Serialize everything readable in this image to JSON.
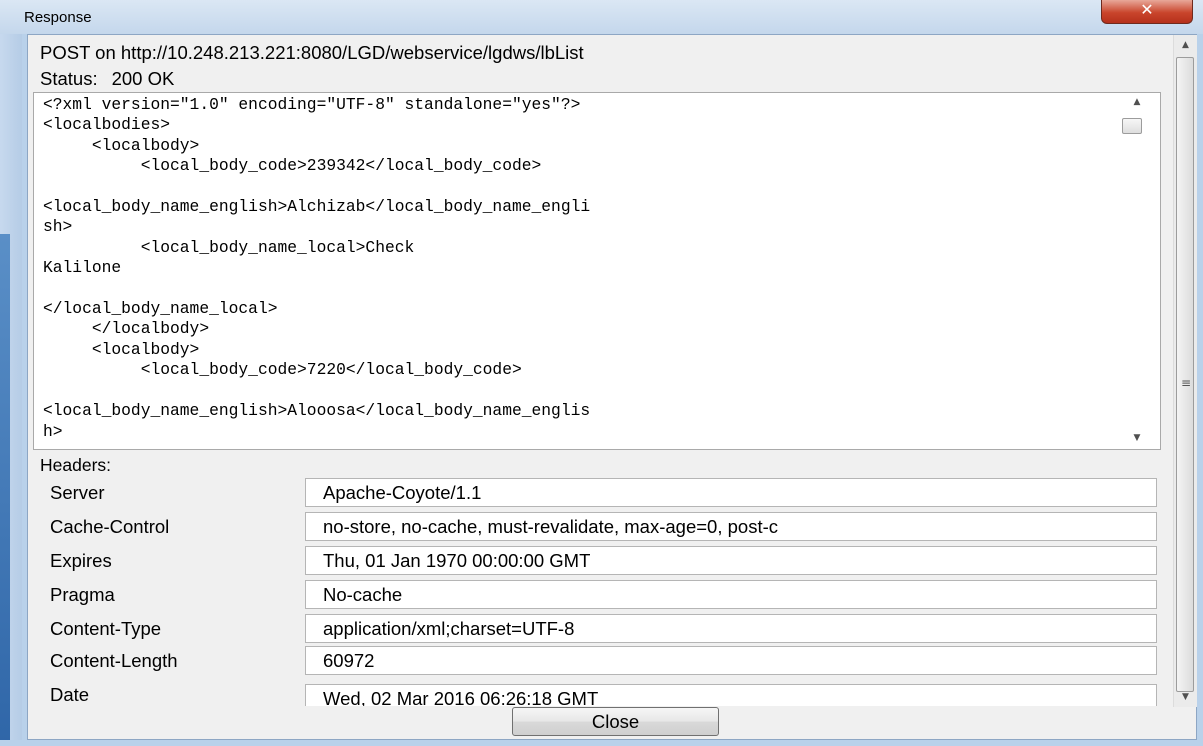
{
  "window": {
    "title": "Response",
    "close_glyph": "✕"
  },
  "request": {
    "line": "POST on http://10.248.213.221:8080/LGD/webservice/lgdws/lbList",
    "status_label": "Status:",
    "status_value": "200 OK"
  },
  "body": {
    "text": "<?xml version=\"1.0\" encoding=\"UTF-8\" standalone=\"yes\"?>\n<localbodies>\n     <localbody>\n          <local_body_code>239342</local_body_code>\n\n<local_body_name_english>Alchizab</local_body_name_engli\nsh>\n          <local_body_name_local>Check\nKalilone\n\n</local_body_name_local>\n     </localbody>\n     <localbody>\n          <local_body_code>7220</local_body_code>\n\n<local_body_name_english>Alooosa</local_body_name_englis\nh>\n\n<local_body_name_local>Alooosa\n               </local_body_name_local>"
  },
  "headers": {
    "label": "Headers:",
    "rows": [
      {
        "name": "Server",
        "value": "Apache-Coyote/1.1"
      },
      {
        "name": "Cache-Control",
        "value": "no-store, no-cache, must-revalidate, max-age=0, post-c"
      },
      {
        "name": "Expires",
        "value": "Thu, 01 Jan 1970 00:00:00 GMT"
      },
      {
        "name": "Pragma",
        "value": "No-cache"
      },
      {
        "name": "Content-Type",
        "value": "application/xml;charset=UTF-8"
      },
      {
        "name": "Content-Length",
        "value": "60972"
      },
      {
        "name": "Date",
        "value": "Wed, 02 Mar 2016 06:26:18 GMT"
      }
    ]
  },
  "buttons": {
    "close_label": "Close"
  },
  "icons": {
    "scroll_up": "scroll-up-arrow-icon",
    "scroll_down": "scroll-down-arrow-icon",
    "grip": "scroll-grip-icon"
  }
}
